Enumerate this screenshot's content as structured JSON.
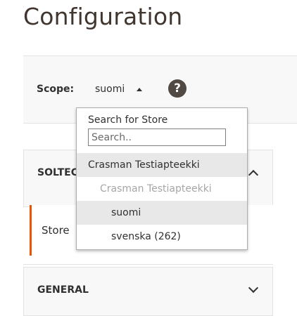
{
  "page": {
    "title": "Configuration"
  },
  "scope": {
    "label": "Scope:",
    "value": "suomi",
    "help_glyph": "?"
  },
  "dropdown": {
    "search_label": "Search for Store",
    "search_placeholder": "Search..",
    "search_value": "",
    "items": [
      {
        "label": "Crasman Testiapteekki",
        "level": "website",
        "highlighted": true
      },
      {
        "label": "Crasman Testiapteekki",
        "level": "store",
        "disabled": true
      },
      {
        "label": "suomi",
        "level": "store-view",
        "selected": true
      },
      {
        "label": "svenska (262)",
        "level": "store-view"
      }
    ]
  },
  "sections": {
    "soltec": {
      "title": "SOLTEC",
      "expanded": true,
      "items": [
        {
          "label": "Store",
          "active": true
        }
      ]
    },
    "general": {
      "title": "GENERAL",
      "expanded": false
    }
  },
  "colors": {
    "accent": "#eb5202",
    "help_icon_bg": "#514943",
    "panel_bg": "#f8f8f8",
    "row_highlight": "#e8e8e8"
  },
  "icons": {
    "caret": "caret-up-icon",
    "help": "question-circle-icon",
    "collapse": "chevron-up-icon",
    "expand": "chevron-down-icon"
  }
}
